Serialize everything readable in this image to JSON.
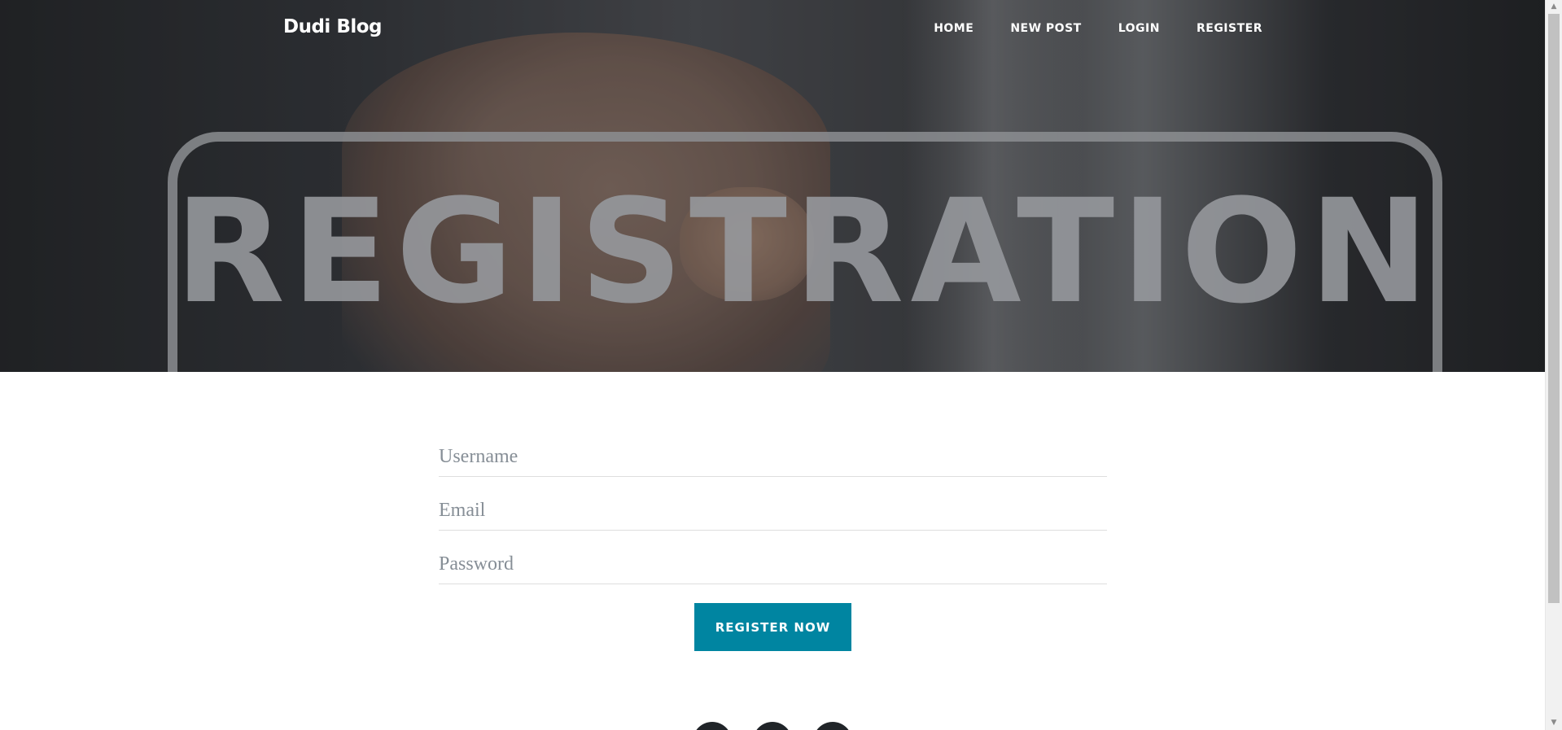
{
  "brand": {
    "name": "Dudi Blog"
  },
  "nav": {
    "items": [
      {
        "label": "HOME"
      },
      {
        "label": "NEW POST"
      },
      {
        "label": "LOGIN"
      },
      {
        "label": "REGISTER"
      }
    ]
  },
  "hero": {
    "word": "REGISTRATION"
  },
  "form": {
    "username": {
      "placeholder": "Username",
      "value": ""
    },
    "email": {
      "placeholder": "Email",
      "value": ""
    },
    "password": {
      "placeholder": "Password",
      "value": ""
    },
    "submit_label": "REGISTER NOW"
  },
  "footer": {
    "social_icons": [
      "social-icon-1",
      "social-icon-2",
      "social-icon-3"
    ]
  },
  "colors": {
    "accent": "#0085a1",
    "navbar_text": "#ffffff",
    "placeholder": "#868e96",
    "footer_icon": "#212529"
  }
}
